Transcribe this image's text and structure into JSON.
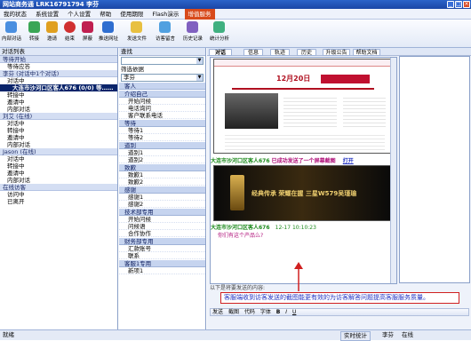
{
  "window": {
    "title": "网站商务通 LRK16791794 李芬"
  },
  "menu": [
    "我的状态",
    "系统设置",
    "个人设置",
    "帮助",
    "使用期限",
    "Flash演示",
    "增值服务"
  ],
  "toolbar": {
    "buttons": [
      "内部对话",
      "转接",
      "邀请",
      "结束",
      "屏蔽",
      "推送网址",
      "发送文件",
      "访客留言",
      "历史记录",
      "统计分析"
    ]
  },
  "left": {
    "header": "对话列表",
    "tree": [
      {
        "level": 0,
        "text": "等待开始"
      },
      {
        "level": 1,
        "text": "等待应答"
      },
      {
        "level": 0,
        "text": "李芬 (对话中1个对话)"
      },
      {
        "level": 1,
        "text": "对话中"
      },
      {
        "level": 2,
        "text": "大连市沙河口区客人676 (0/0) 等……"
      },
      {
        "level": 1,
        "text": "转接中"
      },
      {
        "level": 1,
        "text": "邀请中"
      },
      {
        "level": 1,
        "text": "内部对话"
      },
      {
        "level": 0,
        "text": "刘艾 (在线)"
      },
      {
        "level": 1,
        "text": "对话中"
      },
      {
        "level": 1,
        "text": "转接中"
      },
      {
        "level": 1,
        "text": "邀请中"
      },
      {
        "level": 1,
        "text": "内部对话"
      },
      {
        "level": 0,
        "text": "Jason (在线)"
      },
      {
        "level": 1,
        "text": "对话中"
      },
      {
        "level": 1,
        "text": "转接中"
      },
      {
        "level": 1,
        "text": "邀请中"
      },
      {
        "level": 1,
        "text": "内部对话"
      },
      {
        "level": 0,
        "text": "在线访客"
      },
      {
        "level": 1,
        "text": "访问中"
      },
      {
        "level": 1,
        "text": "已离开"
      }
    ]
  },
  "middle": {
    "search_label": "查找",
    "filter_label": "筛选依据",
    "filter_value": "李芬",
    "categories": [
      {
        "name": "客人",
        "items": []
      },
      {
        "name": "介绍自己",
        "items": [
          "开始问候",
          "电话询问",
          "客户联系电话"
        ]
      },
      {
        "name": "等待",
        "items": [
          "等待1",
          "等待2"
        ]
      },
      {
        "name": "道别",
        "items": [
          "道别1",
          "道别2"
        ]
      },
      {
        "name": "致歉",
        "items": [
          "致歉1",
          "致歉2"
        ]
      },
      {
        "name": "感谢",
        "items": [
          "感谢1",
          "感谢2"
        ]
      },
      {
        "name": "技术部专用",
        "items": [
          "开始问候",
          "问候语",
          "合作协作"
        ]
      },
      {
        "name": "财务部专用",
        "items": [
          "汇款账号",
          "联系"
        ]
      },
      {
        "name": "客服1专用",
        "items": [
          "新项1"
        ]
      }
    ]
  },
  "chat": {
    "tabs": [
      "对话",
      "信息",
      "轨迹",
      "历史",
      "升级公告",
      "帮助文档"
    ],
    "msg1": {
      "sender": "大连市沙河口区客人676",
      "text": "已成功发送了一个屏幕截图",
      "link": "打开"
    },
    "banner_date": "12月20日",
    "banner_text": "经典传承 荣耀在握 三星W579吴瑾瑜",
    "msg2": {
      "sender": "大连市沙河口区客人676",
      "time": "12-17 10:10:23",
      "text": "你们有这个产品么?"
    },
    "input_prompt": "以下是将要发送的内容:",
    "format_bar": [
      "发送",
      "截图",
      "代码",
      "字体",
      "B",
      "I",
      "U"
    ],
    "annotation": "客服端收到访客发送的截图能更有效的为访客解答问题提高客服服务质量。"
  },
  "status": {
    "left": "就绪",
    "right": [
      "实时统计",
      "李芬",
      "在线"
    ]
  }
}
